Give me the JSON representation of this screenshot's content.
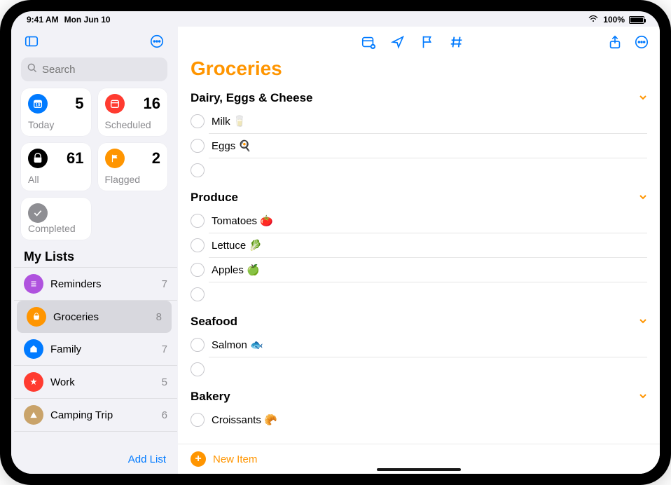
{
  "status": {
    "time": "9:41 AM",
    "date": "Mon Jun 10",
    "battery_pct": "100%"
  },
  "sidebar": {
    "search_placeholder": "Search",
    "smart": [
      {
        "id": "today",
        "label": "Today",
        "count": "5",
        "color": "#007aff"
      },
      {
        "id": "scheduled",
        "label": "Scheduled",
        "count": "16",
        "color": "#ff3b30"
      },
      {
        "id": "all",
        "label": "All",
        "count": "61",
        "color": "#000000"
      },
      {
        "id": "flagged",
        "label": "Flagged",
        "count": "2",
        "color": "#ff9500"
      },
      {
        "id": "completed",
        "label": "Completed",
        "count": "",
        "color": "#8e8e93"
      }
    ],
    "section_title": "My Lists",
    "lists": [
      {
        "name": "Reminders",
        "count": "7",
        "color": "#af52de",
        "selected": false
      },
      {
        "name": "Groceries",
        "count": "8",
        "color": "#ff9500",
        "selected": true
      },
      {
        "name": "Family",
        "count": "7",
        "color": "#007aff",
        "selected": false
      },
      {
        "name": "Work",
        "count": "5",
        "color": "#ff3b30",
        "selected": false
      },
      {
        "name": "Camping Trip",
        "count": "6",
        "color": "#c9a36a",
        "selected": false
      }
    ],
    "add_list_label": "Add List"
  },
  "main": {
    "title": "Groceries",
    "new_item_label": "New Item",
    "sections": [
      {
        "name": "Dairy, Eggs & Cheese",
        "items": [
          "Milk 🥛",
          "Eggs 🍳",
          ""
        ]
      },
      {
        "name": "Produce",
        "items": [
          "Tomatoes 🍅",
          "Lettuce 🥬",
          "Apples 🍏",
          ""
        ]
      },
      {
        "name": "Seafood",
        "items": [
          "Salmon 🐟",
          ""
        ]
      },
      {
        "name": "Bakery",
        "items": [
          "Croissants 🥐"
        ]
      }
    ]
  }
}
